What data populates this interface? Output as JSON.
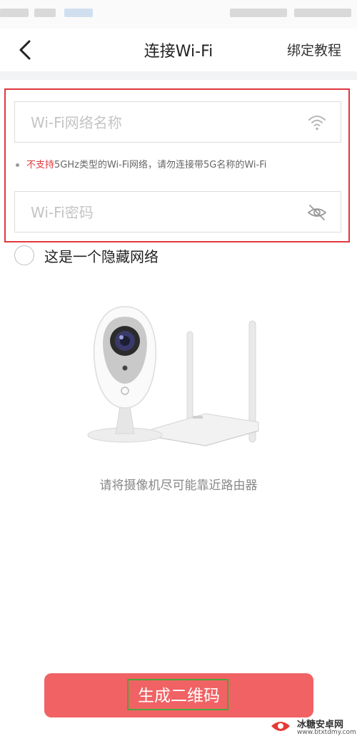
{
  "header": {
    "title": "连接Wi-Fi",
    "tutorial_label": "绑定教程"
  },
  "form": {
    "ssid_placeholder": "Wi-Fi网络名称",
    "ssid_value": "",
    "note_warn": "不支持",
    "note_rest": "5GHz类型的Wi-Fi网络，请勿连接带5G名称的Wi-Fi",
    "password_placeholder": "Wi-Fi密码",
    "password_value": "",
    "hidden_network_label": "这是一个隐藏网络",
    "hidden_network_checked": false
  },
  "illustration": {
    "caption": "请将摄像机尽可能靠近路由器"
  },
  "action": {
    "generate_label": "生成二维码"
  },
  "watermark": {
    "name": "冰糖安卓网",
    "url": "www.btxtdmy.com"
  },
  "colors": {
    "accent": "#f16264",
    "warning": "#e0383e",
    "highlight": "#4aa53a"
  }
}
